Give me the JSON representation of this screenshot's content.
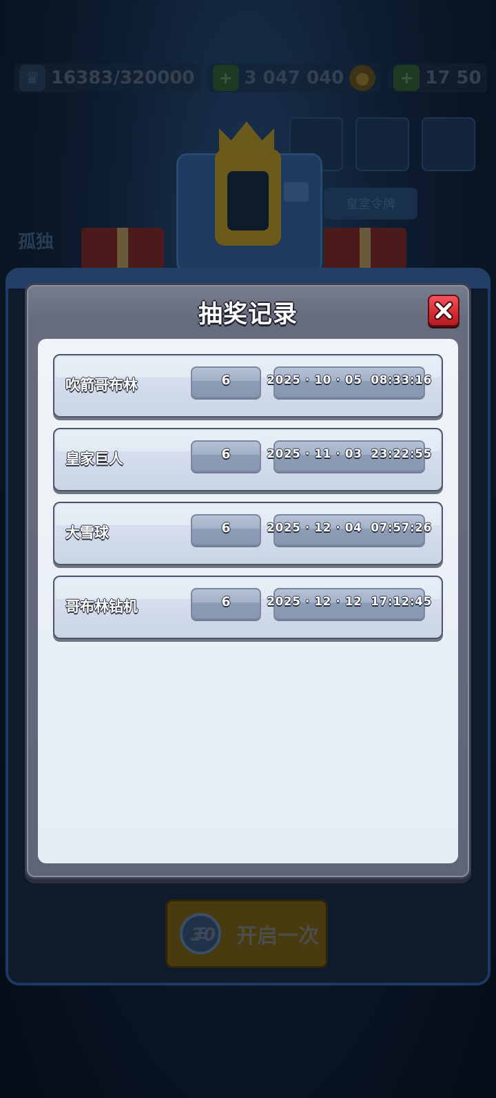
{
  "background": {
    "resources": [
      {
        "icon": "trophy-icon",
        "text": "16383/320000"
      },
      {
        "icon": "cash-icon",
        "text": "3 047 040"
      },
      {
        "icon": "gem-icon",
        "text": "17 50"
      }
    ],
    "side_text": "孤独",
    "chip_text": "皇室令牌",
    "open_button": {
      "cost": "30",
      "label": "开启一次"
    }
  },
  "dialog": {
    "title": "抽奖记录",
    "close_icon": "close-x-icon",
    "records": [
      {
        "name": "吹箭哥布林",
        "count": "6",
        "time": "2025 · 10 · 05  08:33:16"
      },
      {
        "name": "皇家巨人",
        "count": "6",
        "time": "2025 · 11 · 03  23:22:55"
      },
      {
        "name": "大雪球",
        "count": "6",
        "time": "2025 · 12 · 04  07:57:26"
      },
      {
        "name": "哥布林钻机",
        "count": "6",
        "time": "2025 · 12 · 12  17:12:45"
      }
    ]
  },
  "colors": {
    "close_button": "#d42a31",
    "dialog_frame": "#666c7d",
    "list_panel": "#e4edf3",
    "row_fill": "#d2dcec"
  }
}
